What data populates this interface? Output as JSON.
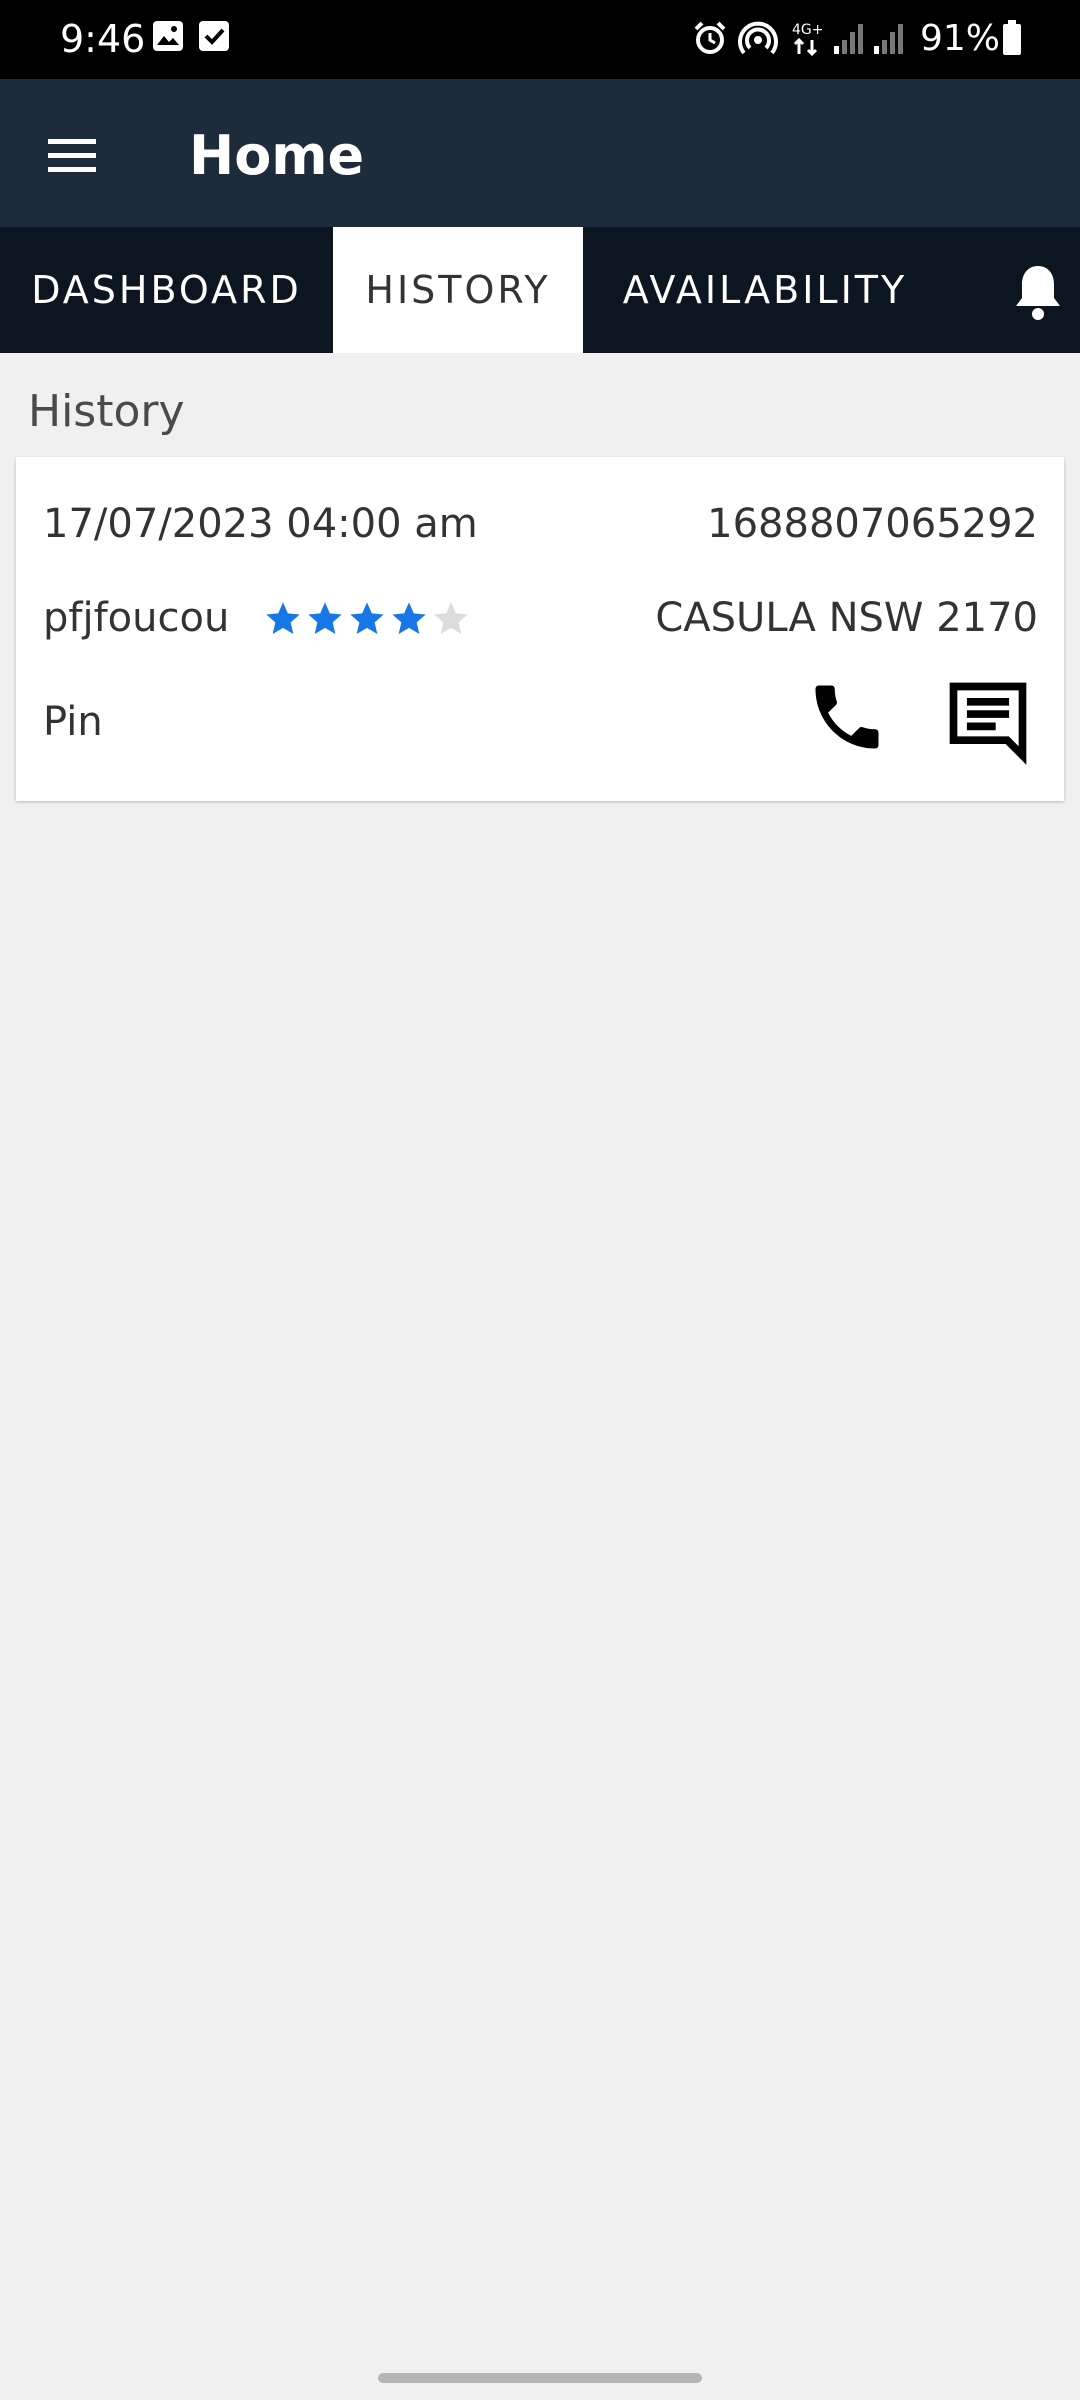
{
  "status_bar": {
    "time": "9:46",
    "battery": "91%"
  },
  "app_bar": {
    "title": "Home"
  },
  "tabs": [
    {
      "label": "DASHBOARD",
      "active": false
    },
    {
      "label": "HISTORY",
      "active": true
    },
    {
      "label": "AVAILABILITY",
      "active": false
    }
  ],
  "history": {
    "title": "History",
    "items": [
      {
        "datetime": "17/07/2023 04:00 am",
        "id": "1688807065292",
        "name": "pfjfoucou",
        "rating": 4,
        "rating_max": 5,
        "location": "CASULA NSW 2170",
        "pin": "Pin"
      }
    ]
  },
  "colors": {
    "status_bar": "#000000",
    "app_bar": "#1d2b3a",
    "tab_bar": "#0c1620",
    "star_filled": "#1877e6",
    "star_empty": "#dcdcdc"
  }
}
